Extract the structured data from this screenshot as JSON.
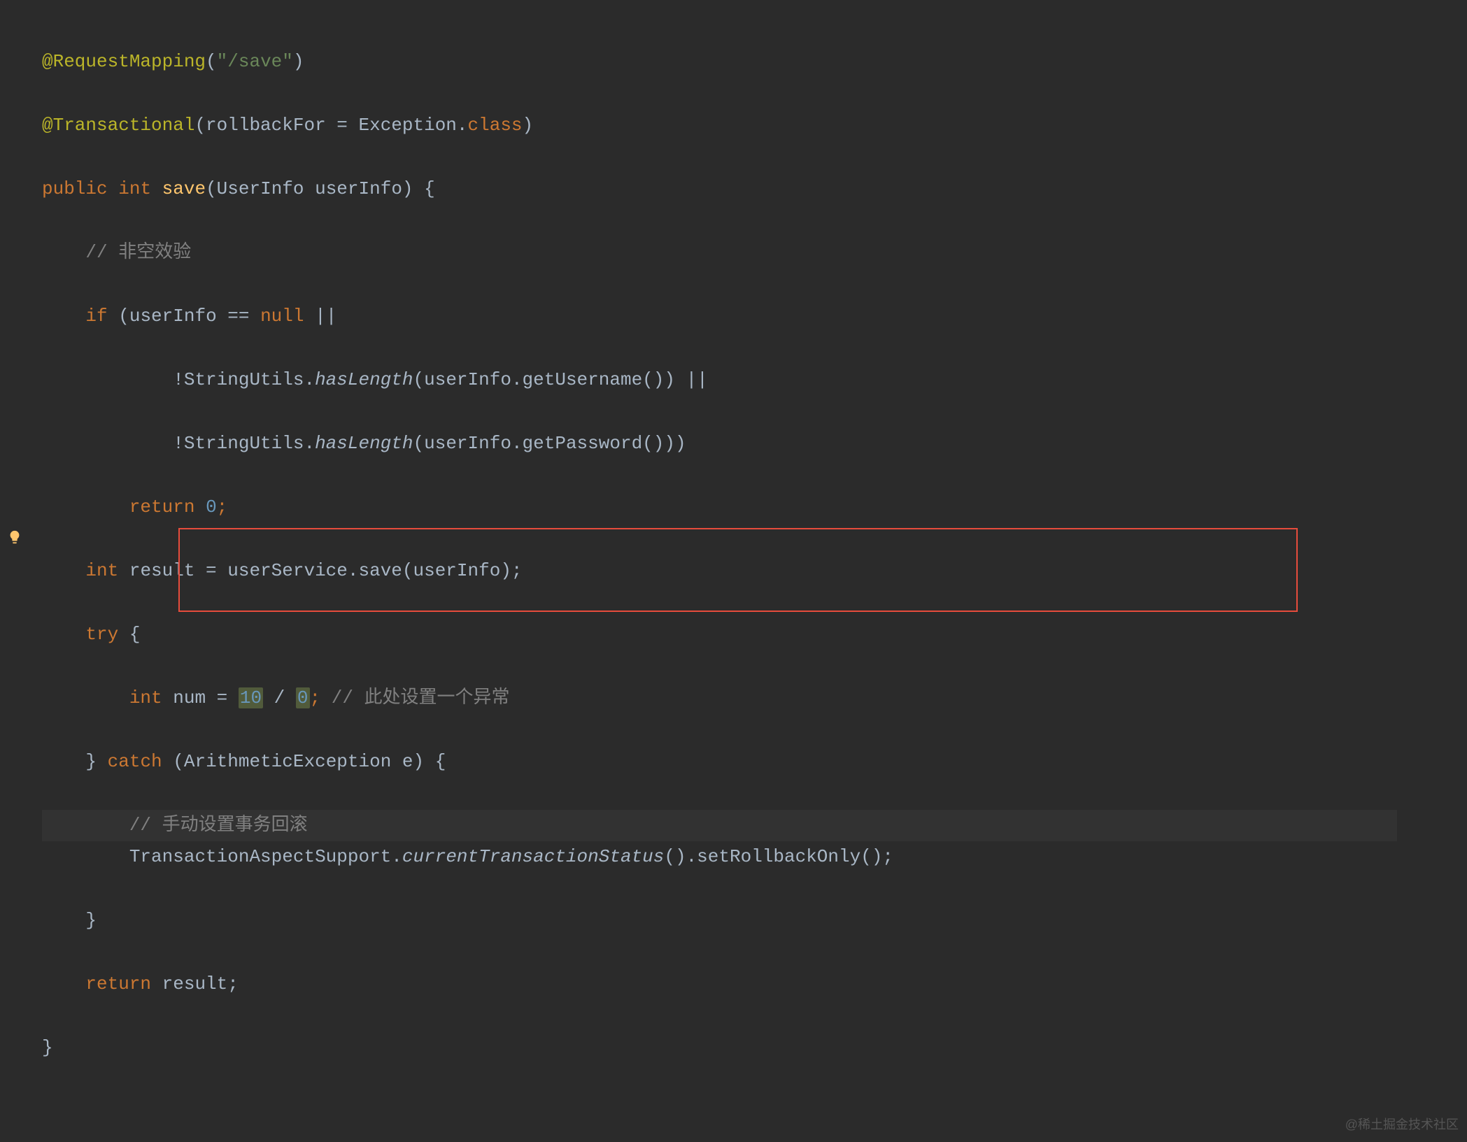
{
  "watermark": "@稀土掘金技术社区",
  "code": {
    "l1": {
      "ann": "@RequestMapping",
      "paren_open": "(",
      "str": "\"/save\"",
      "paren_close": ")"
    },
    "l2": {
      "ann": "@Transactional",
      "paren_open": "(",
      "param": "rollbackFor = Exception.",
      "kw": "class",
      "paren_close": ")"
    },
    "l3": {
      "kw1": "public",
      "kw2": "int",
      "method": "save",
      "params": "(UserInfo userInfo) {"
    },
    "l4": {
      "comment": "// 非空效验"
    },
    "l5": {
      "kw": "if",
      "cond": " (userInfo == ",
      "nullkw": "null",
      "rest": " ||"
    },
    "l6": {
      "pre": "!StringUtils.",
      "method": "hasLength",
      "post": "(userInfo.getUsername()) ||"
    },
    "l7": {
      "pre": "!StringUtils.",
      "method": "hasLength",
      "post": "(userInfo.getPassword()))"
    },
    "l8": {
      "kw": "return",
      "num": "0",
      "semi": ";"
    },
    "l9": {
      "kw": "int",
      "var": " result = userService.save(userInfo);"
    },
    "l10": {
      "kw": "try",
      "brace": " {"
    },
    "l11": {
      "kw": "int",
      "var": " num = ",
      "n1": "10",
      "op": " / ",
      "n2": "0",
      "semi": "; ",
      "comment": "// 此处设置一个异常"
    },
    "l12": {
      "brace1": "} ",
      "kw": "catch",
      "rest": " (ArithmeticException e) {"
    },
    "l13": {
      "comment": "// 手动设置事务回滚"
    },
    "l14": {
      "pre": "TransactionAspectSupport.",
      "method": "currentTransactionStatus",
      "post": "().setRollbackOnly();"
    },
    "l15": {
      "brace": "}"
    },
    "l16": {
      "kw": "return",
      "rest": " result;"
    },
    "l17": {
      "brace": "}"
    }
  }
}
